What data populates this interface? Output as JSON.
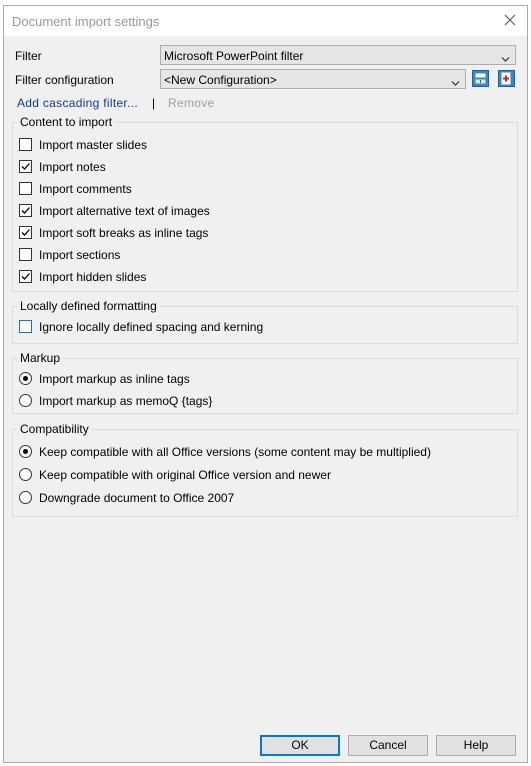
{
  "window": {
    "title": "Document import settings"
  },
  "filter": {
    "label": "Filter",
    "value": "Microsoft PowerPoint filter"
  },
  "filter_config": {
    "label": "Filter configuration",
    "value": "<New Configuration>"
  },
  "links": {
    "add_cascading": "Add cascading filter...",
    "separator": "|",
    "remove": "Remove"
  },
  "content_group": {
    "legend": "Content to import",
    "items": [
      {
        "label": "Import master slides",
        "checked": false
      },
      {
        "label": "Import notes",
        "checked": true
      },
      {
        "label": "Import comments",
        "checked": false
      },
      {
        "label": "Import alternative text of images",
        "checked": true
      },
      {
        "label": "Import soft breaks as inline tags",
        "checked": true
      },
      {
        "label": "Import sections",
        "checked": false
      },
      {
        "label": "Import hidden slides",
        "checked": true
      }
    ]
  },
  "formatting_group": {
    "legend": "Locally defined formatting",
    "items": [
      {
        "label": "Ignore locally defined spacing and kerning",
        "checked": false
      }
    ]
  },
  "markup_group": {
    "legend": "Markup",
    "items": [
      {
        "label": "Import markup as inline tags",
        "selected": true
      },
      {
        "label": "Import markup as memoQ {tags}",
        "selected": false
      }
    ]
  },
  "compat_group": {
    "legend": "Compatibility",
    "items": [
      {
        "label": "Keep compatible with all Office versions (some content may be multiplied)",
        "selected": true
      },
      {
        "label": "Keep compatible with original Office version and newer",
        "selected": false
      },
      {
        "label": "Downgrade document to Office 2007",
        "selected": false
      }
    ]
  },
  "buttons": {
    "ok": "OK",
    "cancel": "Cancel",
    "help": "Help"
  },
  "colors": {
    "accent": "#0078d7",
    "link": "#0b3aa6",
    "disabled": "#a0a0a0"
  }
}
